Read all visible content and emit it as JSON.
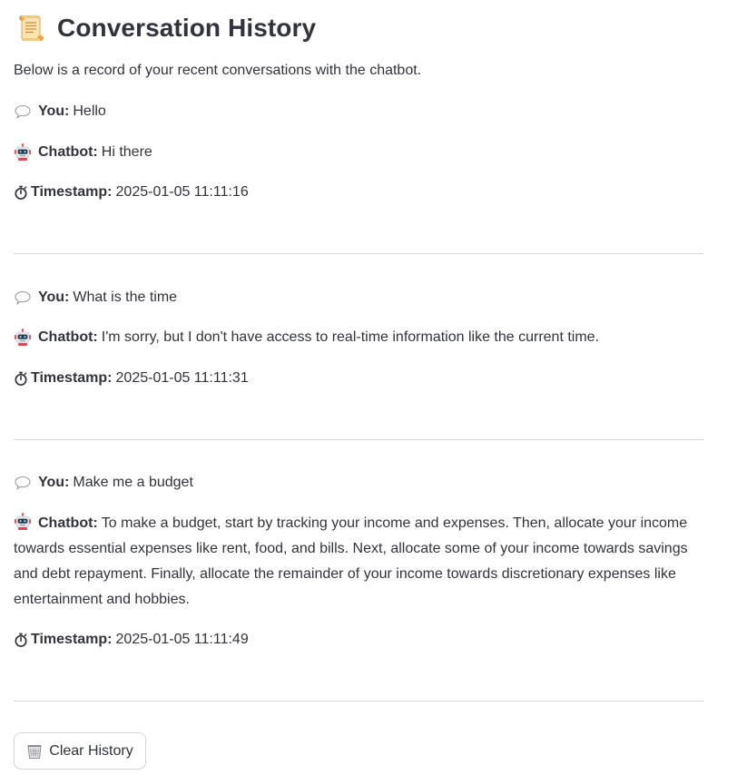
{
  "header": {
    "title_icon": "scroll-icon",
    "title": "Conversation History",
    "intro": "Below is a record of your recent conversations with the chatbot."
  },
  "labels": {
    "you": "You:",
    "chatbot": "Chatbot:",
    "timestamp": "Timestamp:"
  },
  "conversations": [
    {
      "user": "Hello",
      "bot": "Hi there",
      "timestamp": "2025-01-05 11:11:16"
    },
    {
      "user": "What is the time",
      "bot": "I'm sorry, but I don't have access to real-time information like the current time.",
      "timestamp": "2025-01-05 11:11:31"
    },
    {
      "user": "Make me a budget",
      "bot": "To make a budget, start by tracking your income and expenses. Then, allocate your income towards essential expenses like rent, food, and bills. Next, allocate some of your income towards savings and debt repayment. Finally, allocate the remainder of your income towards discretionary expenses like entertainment and hobbies.",
      "timestamp": "2025-01-05 11:11:49"
    }
  ],
  "clear_button": {
    "icon": "wastebasket-icon",
    "label": "Clear History"
  },
  "icons": {
    "you": "speech-balloon-icon",
    "chatbot": "robot-icon",
    "timestamp": "stopwatch-icon"
  }
}
